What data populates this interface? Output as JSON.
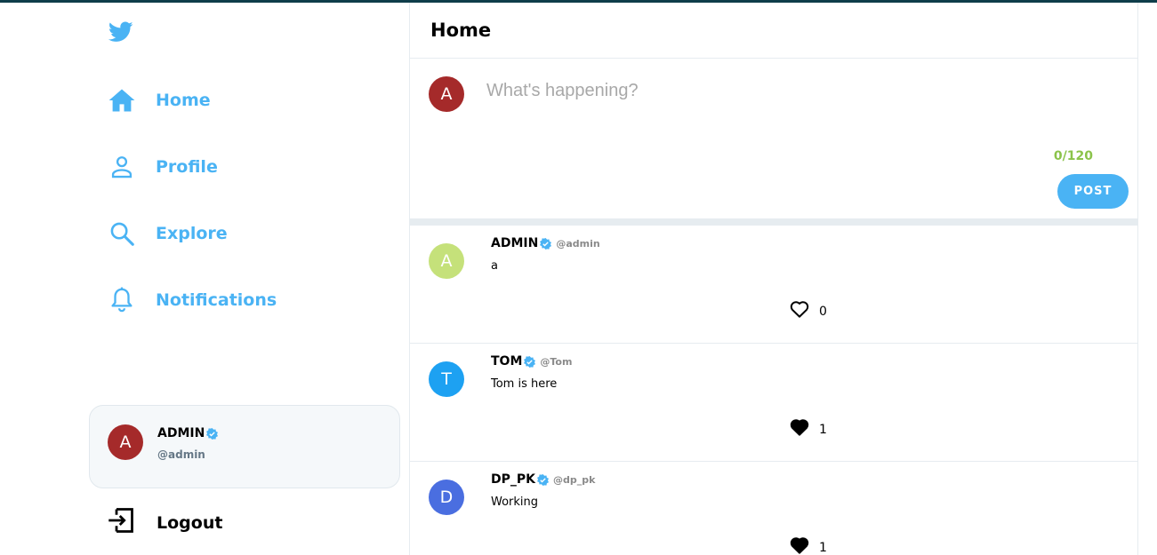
{
  "brand": {
    "logo_icon": "twitter-bird-icon",
    "color": "#4ab3f4"
  },
  "nav": {
    "home": "Home",
    "profile": "Profile",
    "explore": "Explore",
    "notifications": "Notifications"
  },
  "account": {
    "avatar_letter": "A",
    "name": "ADMIN",
    "handle": "@admin",
    "verified": true
  },
  "logout_label": "Logout",
  "main": {
    "title": "Home",
    "composer": {
      "avatar_letter": "A",
      "placeholder": "What's happening?",
      "char_count": "0/120",
      "post_label": "POST"
    }
  },
  "tweets": [
    {
      "avatar_letter": "A",
      "avatar_color": "#c5e17a",
      "name": "ADMIN",
      "handle": "@admin",
      "text": "a",
      "likes": "0",
      "liked": false
    },
    {
      "avatar_letter": "T",
      "avatar_color": "#1da1f2",
      "name": "TOM",
      "handle": "@Tom",
      "text": "Tom is here",
      "likes": "1",
      "liked": true
    },
    {
      "avatar_letter": "D",
      "avatar_color": "#4a6ee0",
      "name": "DP_PK",
      "handle": "@dp_pk",
      "text": "Working",
      "likes": "1",
      "liked": true
    }
  ]
}
